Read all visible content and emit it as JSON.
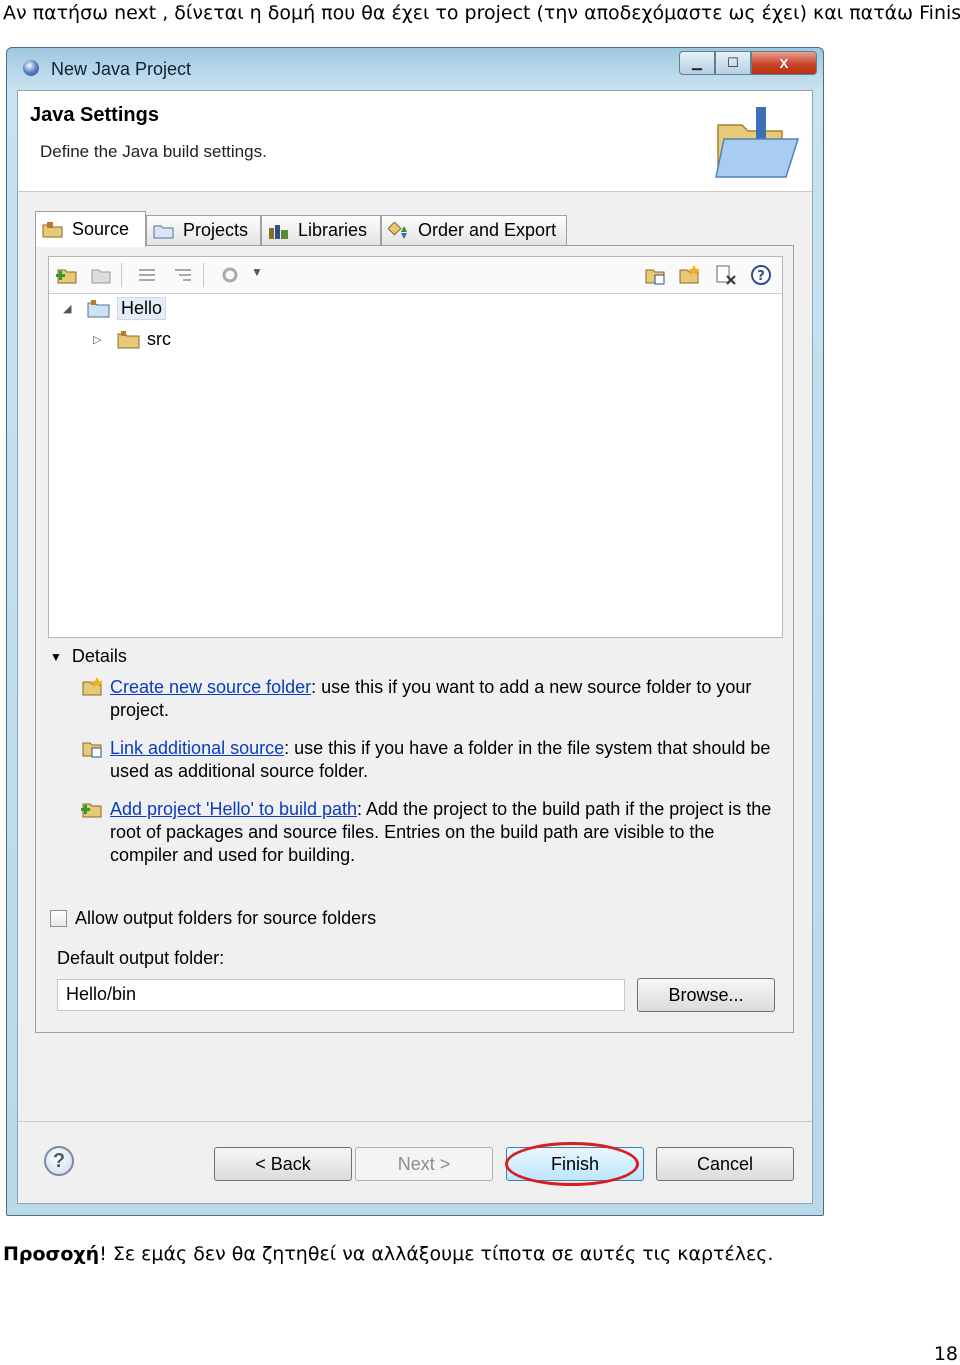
{
  "doc": {
    "intro": "Αν πατήσω next , δίνεται η  δομή που θα έχει το project (την αποδεχόμαστε ως έχει) και πατάω Finish:",
    "note_bold": "Προσοχή",
    "note_rest": "! Σε εμάς δεν θα ζητηθεί να αλλάξουμε τίποτα σε αυτές τις καρτέλες.",
    "page_number": "18"
  },
  "window": {
    "title": "New Java Project",
    "controls": {
      "minimize": "▁",
      "maximize": "☐",
      "close": "X"
    }
  },
  "banner": {
    "title": "Java Settings",
    "description": "Define the Java build settings."
  },
  "tabs": [
    {
      "label": "Source",
      "icon": "source-folder-icon",
      "active": true
    },
    {
      "label": "Projects",
      "icon": "projects-icon",
      "active": false
    },
    {
      "label": "Libraries",
      "icon": "libraries-icon",
      "active": false
    },
    {
      "label": "Order and Export",
      "icon": "order-export-icon",
      "active": false
    }
  ],
  "tree": {
    "root": {
      "label": "Hello",
      "expander": "◢"
    },
    "child": {
      "label": "src",
      "expander": "▷"
    }
  },
  "details": {
    "heading": "Details",
    "items": [
      {
        "link": "Create new source folder",
        "text": ": use this if you want to add a new source folder to your project.",
        "icon": "new-source-folder-icon"
      },
      {
        "link": "Link additional source",
        "text": ": use this if you have a folder in the file system that should be used as additional source folder.",
        "icon": "link-source-icon"
      },
      {
        "link": "Add project 'Hello' to build path",
        "text": ": Add the project to the build path if the project is the root of packages and source files. Entries on the build path are visible to the compiler and used for building.",
        "icon": "add-to-build-path-icon"
      }
    ]
  },
  "output": {
    "checkbox_label": "Allow output folders for source folders",
    "checked": false,
    "folder_label": "Default output folder:",
    "folder_value": "Hello/bin",
    "browse_label": "Browse..."
  },
  "footer": {
    "help": "?",
    "back": "< Back",
    "next": "Next >",
    "finish": "Finish",
    "cancel": "Cancel"
  },
  "colors": {
    "link": "#0a3cbf",
    "highlight_circle": "#d81e1e",
    "title_bar": "#9ec8df"
  }
}
